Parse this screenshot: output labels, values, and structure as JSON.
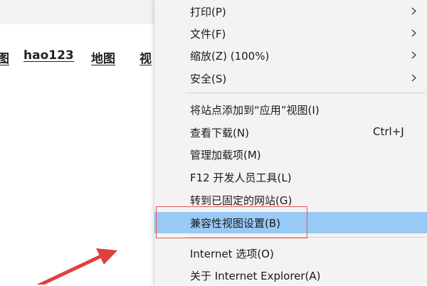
{
  "page": {
    "nav_links": [
      "图",
      "hao123",
      "地图",
      "视"
    ]
  },
  "context_menu": {
    "items": [
      {
        "label": "打印(P)",
        "submenu": true
      },
      {
        "label": "文件(F)",
        "submenu": true
      },
      {
        "label": "缩放(Z) (100%)",
        "submenu": true
      },
      {
        "label": "安全(S)",
        "submenu": true
      },
      {
        "label": "将站点添加到“应用”视图(I)"
      },
      {
        "label": "查看下载(N)",
        "shortcut": "Ctrl+J"
      },
      {
        "label": "管理加载项(M)"
      },
      {
        "label": "F12 开发人员工具(L)"
      },
      {
        "label": "转到已固定的网站(G)"
      },
      {
        "label": "兼容性视图设置(B)",
        "highlighted": true
      },
      {
        "label": "Internet 选项(O)"
      },
      {
        "label": "关于 Internet Explorer(A)"
      }
    ]
  },
  "icons": {
    "submenu_arrow": "chevron-right-icon",
    "pointer": "red-arrow-icon"
  },
  "colors": {
    "menu_background": "#f3f3f3",
    "highlight_background": "#99c9f5",
    "annotation_red": "#e04040"
  }
}
